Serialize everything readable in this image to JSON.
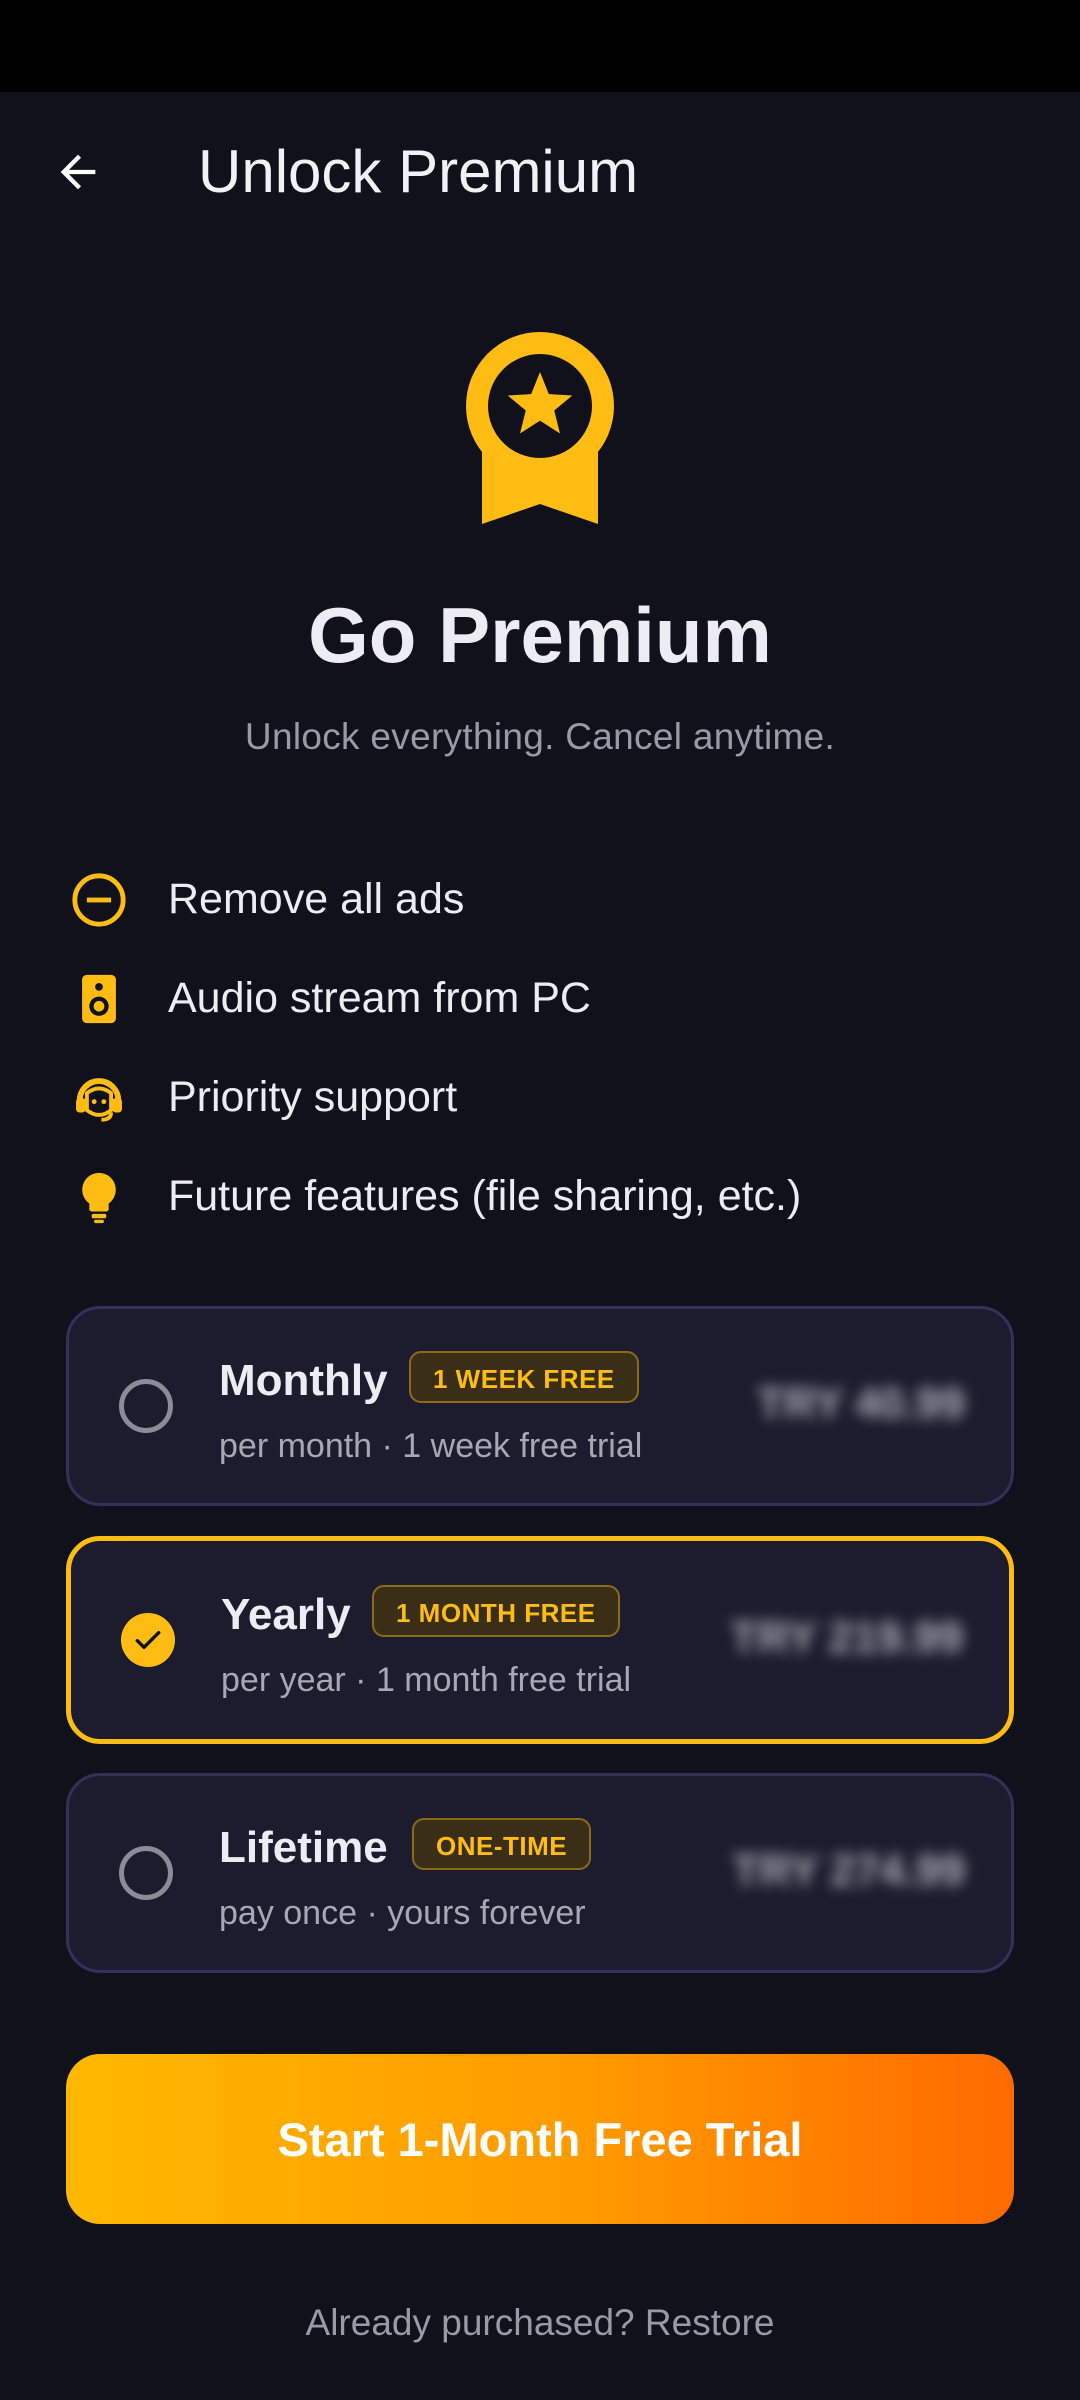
{
  "app_bar": {
    "title": "Unlock Premium"
  },
  "hero": {
    "title": "Go Premium",
    "subtitle": "Unlock everything. Cancel anytime."
  },
  "features": [
    {
      "icon": "remove-circle-icon",
      "label": "Remove all ads"
    },
    {
      "icon": "speaker-icon",
      "label": "Audio stream from PC"
    },
    {
      "icon": "support-agent-icon",
      "label": "Priority support"
    },
    {
      "icon": "lightbulb-icon",
      "label": "Future features (file sharing, etc.)"
    }
  ],
  "plans": [
    {
      "name": "Monthly",
      "badge": "1 WEEK FREE",
      "description": "per month · 1 week free trial",
      "price": "TRY 40.99",
      "selected": false
    },
    {
      "name": "Yearly",
      "badge": "1 MONTH FREE",
      "description": "per year · 1 month free trial",
      "price": "TRY 219.99",
      "selected": true
    },
    {
      "name": "Lifetime",
      "badge": "ONE-TIME",
      "description": "pay once · yours forever",
      "price": "TRY 274.99",
      "selected": false
    }
  ],
  "cta": {
    "label": "Start 1-Month Free Trial"
  },
  "restore": {
    "label": "Already purchased? Restore"
  },
  "colors": {
    "accent": "#ffbd14",
    "background": "#10111a",
    "card": "#1c1c2e",
    "cta_start": "#ffb800",
    "cta_end": "#ff6a00"
  }
}
